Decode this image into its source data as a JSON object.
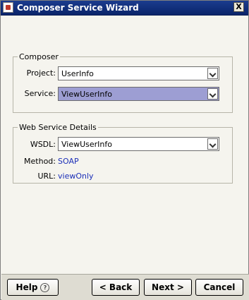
{
  "window": {
    "title": "Composer Service Wizard",
    "close_glyph": "X",
    "icon": "app-icon"
  },
  "composer": {
    "legend": "Composer",
    "project_label": "Project:",
    "project_value": "UserInfo",
    "service_label": "Service:",
    "service_value": "ViewUserInfo"
  },
  "web_service": {
    "legend": "Web Service Details",
    "wsdl_label": "WSDL:",
    "wsdl_value": "ViewUserInfo",
    "method_label": "Method:",
    "method_value": "SOAP",
    "url_label": "URL:",
    "url_value": "viewOnly"
  },
  "buttons": {
    "help": "Help",
    "help_icon": "?",
    "back": "< Back",
    "next": "Next >",
    "cancel": "Cancel"
  },
  "colors": {
    "titlebar": "#0a246a",
    "selected_combo": "#9d9ed3",
    "link_value": "#1c2fb8"
  }
}
